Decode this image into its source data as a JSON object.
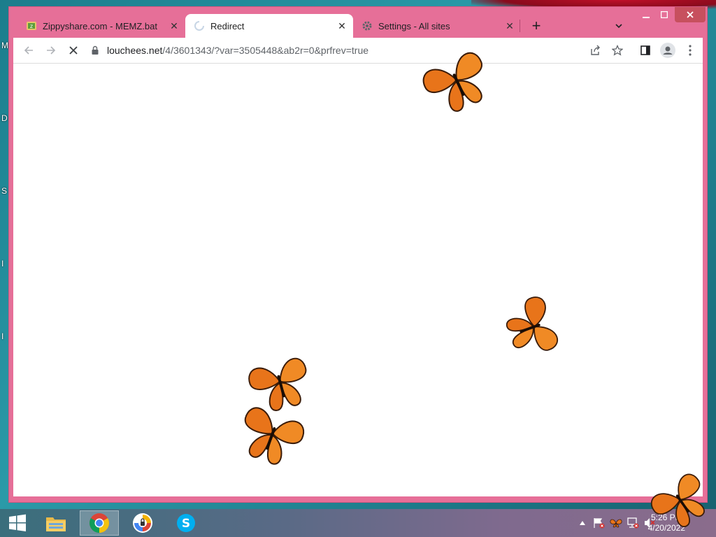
{
  "desktop": {
    "icon_letters": [
      "M",
      "D",
      "S",
      "I",
      "I"
    ]
  },
  "browser": {
    "tabs": [
      {
        "title": "Zippyshare.com - MEMZ.bat",
        "favicon": "zippyshare-icon",
        "active": false
      },
      {
        "title": "Redirect",
        "favicon": "loading-spinner-icon",
        "active": true
      },
      {
        "title": "Settings - All sites",
        "favicon": "gear-icon",
        "active": false
      }
    ],
    "new_tab_label": "+",
    "address": {
      "host": "louchees.net",
      "path": "/4/3601343/?var=3505448&ab2r=0&prfrev=true"
    },
    "accent": "#e66f98"
  },
  "taskbar": {
    "time": "5:26 PM",
    "date": "4/20/2022",
    "pinned": [
      "file-explorer-icon",
      "chrome-icon",
      "security-shield-icon",
      "skype-icon"
    ]
  }
}
